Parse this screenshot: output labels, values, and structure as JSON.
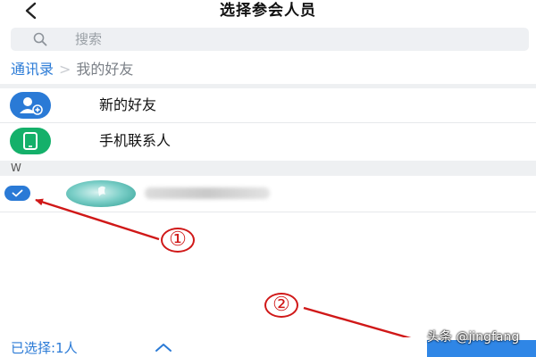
{
  "header": {
    "title": "选择参会人员",
    "back_icon": "chevron-left-icon"
  },
  "search": {
    "placeholder": "搜索",
    "icon": "search-icon"
  },
  "breadcrumb": {
    "root": "通讯录",
    "separator": ">",
    "current": "我的好友"
  },
  "menu": [
    {
      "label": "新的好友",
      "icon": "add-friend-icon",
      "color": "#2a7ad6"
    },
    {
      "label": "手机联系人",
      "icon": "phone-icon",
      "color": "#14b06a"
    }
  ],
  "section": {
    "letter": "W"
  },
  "contact": {
    "checked": true
  },
  "annotations": {
    "one": "①",
    "two": "②",
    "color": "#d01818"
  },
  "footer": {
    "selected": "已选择:1人",
    "watermark": "头条 @jingfang"
  },
  "colors": {
    "accent": "#2a7ad6",
    "confirm": "#2f86e6"
  }
}
